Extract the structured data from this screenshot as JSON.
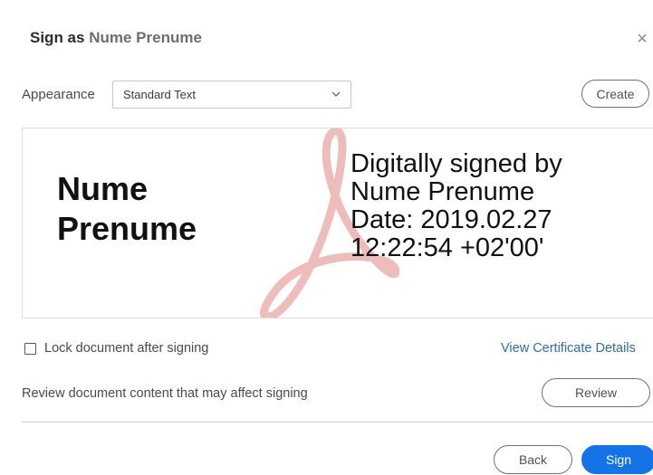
{
  "dialog": {
    "title_prefix": "Sign as",
    "title_name": "Nume Prenume",
    "close_symbol": "×"
  },
  "appearance": {
    "label": "Appearance",
    "selected": "Standard Text",
    "create_label": "Create"
  },
  "preview": {
    "name_line1": "Nume",
    "name_line2": "Prenume",
    "details": [
      "Digitally signed by",
      "Nume Prenume",
      "Date: 2019.02.27",
      "12:22:54 +02'00'"
    ],
    "watermark_icon": "acrobat-logo-icon",
    "watermark_color": "#e8a0a0"
  },
  "options": {
    "lock_label": "Lock document after signing",
    "lock_checked": false,
    "view_certificate": "View Certificate Details",
    "review_text": "Review document content that may affect signing",
    "review_label": "Review"
  },
  "footer": {
    "back_label": "Back",
    "sign_label": "Sign"
  },
  "colors": {
    "accent": "#1473e6",
    "link": "#2d6fa8"
  }
}
